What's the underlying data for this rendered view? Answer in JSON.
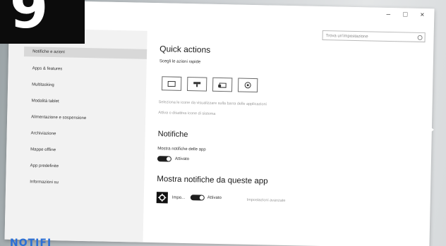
{
  "page_number": "9",
  "bottom_caption": "NOTIFI",
  "window": {
    "controls": [
      "–",
      "□",
      "×"
    ]
  },
  "search": {
    "placeholder": "Trova un'impostazione"
  },
  "sidebar": {
    "items": [
      {
        "label": "Notifiche e azioni",
        "selected": true
      },
      {
        "label": "Apps & features",
        "selected": false
      },
      {
        "label": "Multitasking",
        "selected": false
      },
      {
        "label": "Modalità tablet",
        "selected": false
      },
      {
        "label": "Alimentazione e sospensione",
        "selected": false
      },
      {
        "label": "Archiviazione",
        "selected": false
      },
      {
        "label": "Mappe offline",
        "selected": false
      },
      {
        "label": "App predefinite",
        "selected": false
      },
      {
        "label": "Informazioni su",
        "selected": false
      }
    ]
  },
  "main": {
    "quick_actions_title": "Quick actions",
    "quick_actions_subtitle": "Scegli le azioni rapide",
    "tiles": [
      "tablet-icon",
      "wifi-icon",
      "connect-icon",
      "settings-icon"
    ],
    "select_icons_link": "Seleziona le icone da visualizzare sulla barra delle applicazioni",
    "system_icons_link": "Attiva o disattiva icone di sistema",
    "notifications_title": "Notifiche",
    "show_app_notifications_label": "Mostra notifiche delle app",
    "toggle_state": "Attivato",
    "apps_title": "Mostra notifiche da queste app",
    "app_row": {
      "name": "Impo...",
      "state": "Attivato",
      "advanced": "Impostazioni avanzate"
    }
  },
  "colors": {
    "accent_dark": "#1f1f1f",
    "sidebar_bg": "#f2f2f2",
    "caption_blue": "#2a6fd6"
  }
}
